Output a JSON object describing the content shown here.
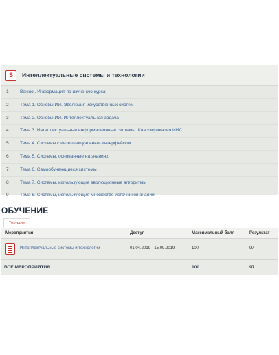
{
  "course": {
    "icon_letter": "S",
    "title": "Интеллектуальные системы и технологии",
    "topics": [
      {
        "num": "1",
        "label": "Важно!. Информация по изучению курса"
      },
      {
        "num": "2",
        "label": "Тема 1. Основы ИИ. Эволюция искусственных систем"
      },
      {
        "num": "3",
        "label": "Тема 2. Основы ИИ. Интеллектуальная задача"
      },
      {
        "num": "4",
        "label": "Тема 3. Интеллектуальные информационные системы. Классификация ИИС"
      },
      {
        "num": "5",
        "label": "Тема 4. Системы с интеллектуальным интерфейсом"
      },
      {
        "num": "6",
        "label": "Тема 5. Системы, основанные на знаниях"
      },
      {
        "num": "7",
        "label": "Тема 6. Самообучающиеся системы"
      },
      {
        "num": "8",
        "label": "Тема 7. Системы, использующие эволюционные алгоритмы"
      },
      {
        "num": "9",
        "label": "Тема 8. Системы, использующие множество источников знаний"
      }
    ]
  },
  "learning": {
    "title": "ОБУЧЕНИЕ",
    "tab_current": "Текущие",
    "columns": {
      "event": "Мероприятия",
      "access": "Доступ",
      "max_score": "Максимальный балл",
      "result": "Результат"
    },
    "rows": [
      {
        "event": "Интеллектуальные системы и технологии",
        "access": "01.04.2019 - 15.09.2019",
        "max_score": "100",
        "result": "97"
      }
    ],
    "total": {
      "label": "ВСЕ МЕРОПРИЯТИЯ",
      "max_score": "100",
      "result": "97"
    }
  },
  "colors": {
    "accent": "#c4302b",
    "link": "#3a6196",
    "panel": "#e7e9e5"
  }
}
